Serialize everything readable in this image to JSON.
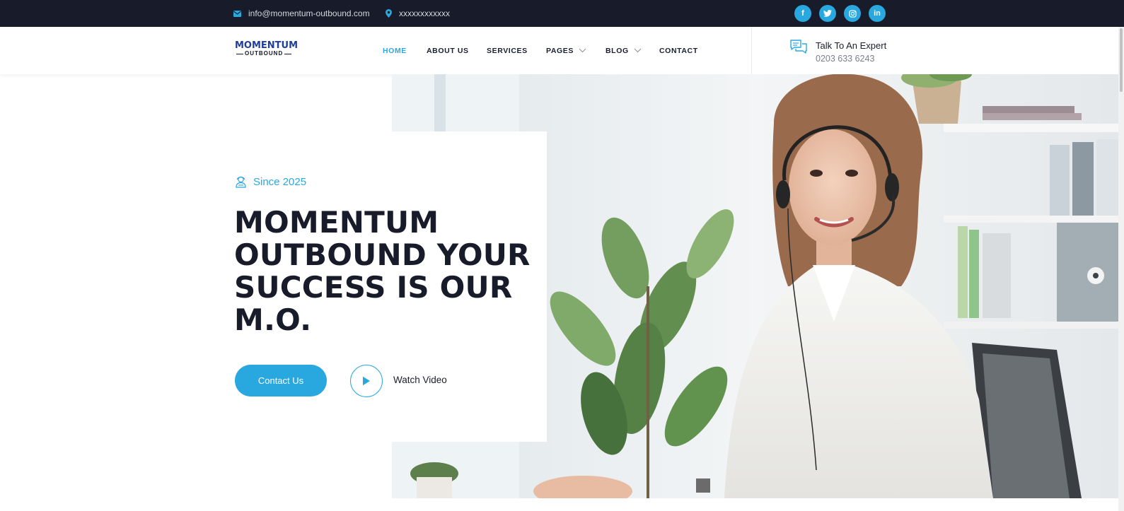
{
  "topbar": {
    "email": "info@momentum-outbound.com",
    "address": "xxxxxxxxxxxx",
    "social": [
      {
        "icon": "facebook-icon",
        "glyph": "f"
      },
      {
        "icon": "twitter-icon",
        "glyph": "t"
      },
      {
        "icon": "instagram-icon",
        "glyph": "◎"
      },
      {
        "icon": "linkedin-icon",
        "glyph": "in"
      }
    ]
  },
  "header": {
    "logo_top": "MOMENTUM",
    "logo_bottom": "OUTBOUND",
    "nav": [
      {
        "label": "HOME",
        "active": true
      },
      {
        "label": "ABOUT US"
      },
      {
        "label": "SERVICES"
      },
      {
        "label": "PAGES",
        "dropdown": true
      },
      {
        "label": "BLOG",
        "dropdown": true
      },
      {
        "label": "CONTACT"
      }
    ],
    "expert_title": "Talk To An Expert",
    "expert_phone": "0203 633 6243"
  },
  "hero": {
    "since": "Since 2025",
    "title": "MOMENTUM OUTBOUND YOUR SUCCESS IS OUR M.O.",
    "contact_button": "Contact Us",
    "watch_video": "Watch Video"
  },
  "colors": {
    "accent": "#29a8e0",
    "dark": "#181c2a",
    "logo_blue": "#1f3d9a"
  }
}
